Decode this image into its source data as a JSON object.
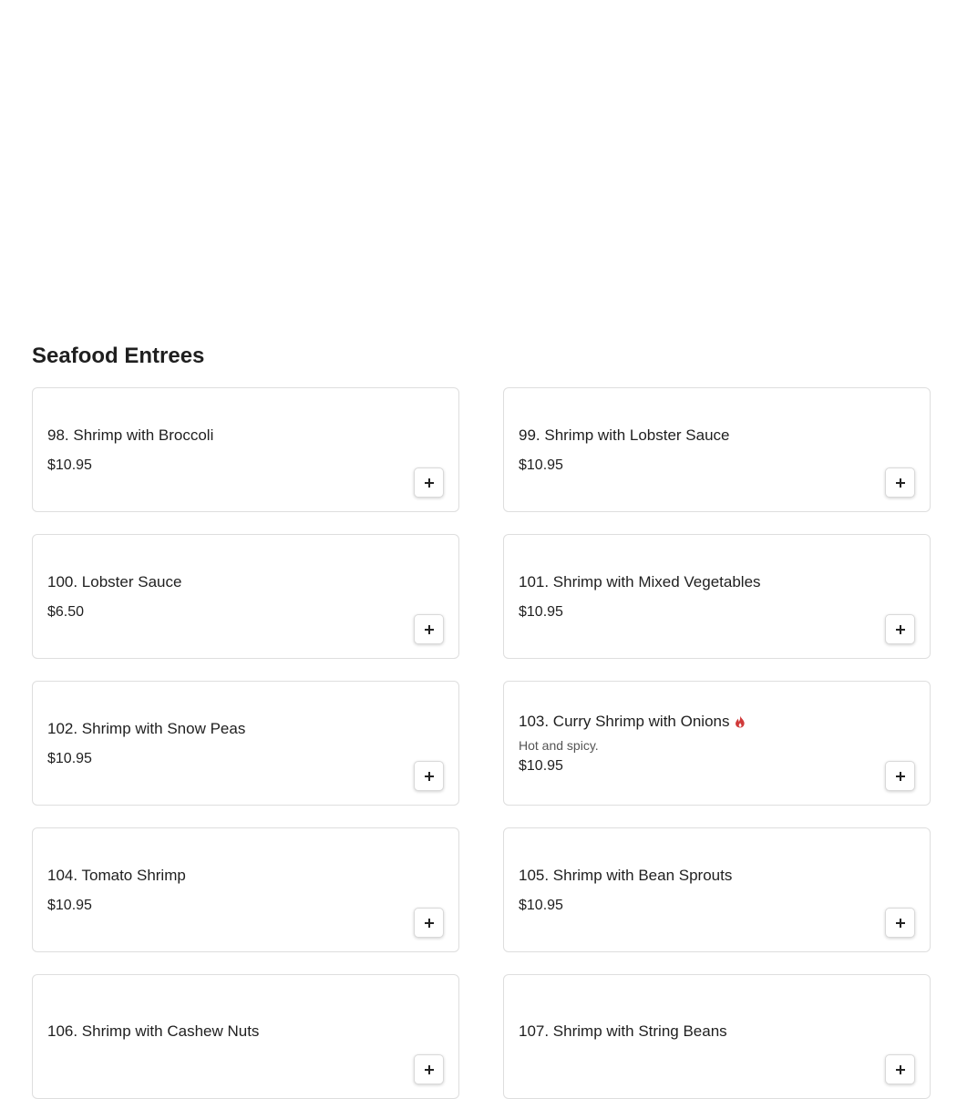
{
  "section": {
    "title": "Seafood Entrees"
  },
  "colors": {
    "spicy_icon": "#d03a3a",
    "card_border": "#dedede"
  },
  "items": [
    {
      "name": "98. Shrimp with Broccoli",
      "price": "$10.95"
    },
    {
      "name": "99. Shrimp with Lobster Sauce",
      "price": "$10.95"
    },
    {
      "name": "100. Lobster Sauce",
      "price": "$6.50"
    },
    {
      "name": "101. Shrimp with Mixed Vegetables",
      "price": "$10.95"
    },
    {
      "name": "102. Shrimp with Snow Peas",
      "price": "$10.95"
    },
    {
      "name": "103. Curry Shrimp with Onions",
      "description": "Hot and spicy.",
      "spicy": true,
      "icon": "fire-icon",
      "price": "$10.95"
    },
    {
      "name": "104. Tomato Shrimp",
      "price": "$10.95"
    },
    {
      "name": "105. Shrimp with Bean Sprouts",
      "price": "$10.95"
    },
    {
      "name": "106. Shrimp with Cashew Nuts",
      "price": ""
    },
    {
      "name": "107. Shrimp with String Beans",
      "price": ""
    }
  ]
}
